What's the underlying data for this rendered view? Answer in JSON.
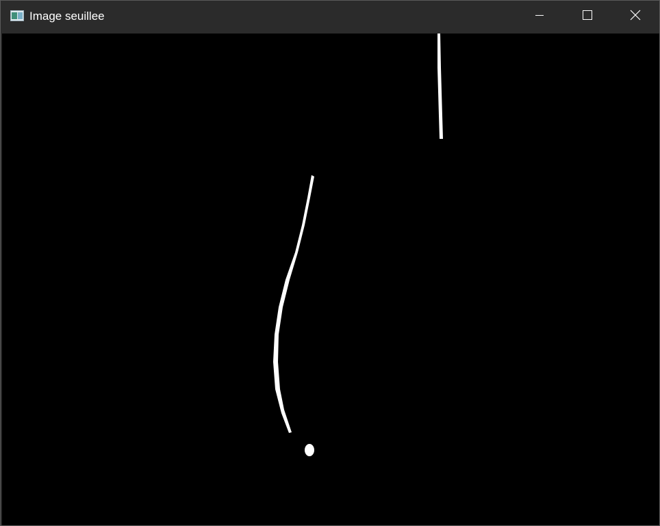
{
  "window": {
    "title": "Image seuillee",
    "app_icon": "opencv-window-icon",
    "buttons": {
      "minimize_icon": "minimize-icon",
      "maximize_icon": "maximize-icon",
      "close_icon": "close-icon"
    }
  },
  "image": {
    "kind": "thresholded binary image",
    "background_color": "#000000",
    "foreground_color": "#ffffff"
  }
}
